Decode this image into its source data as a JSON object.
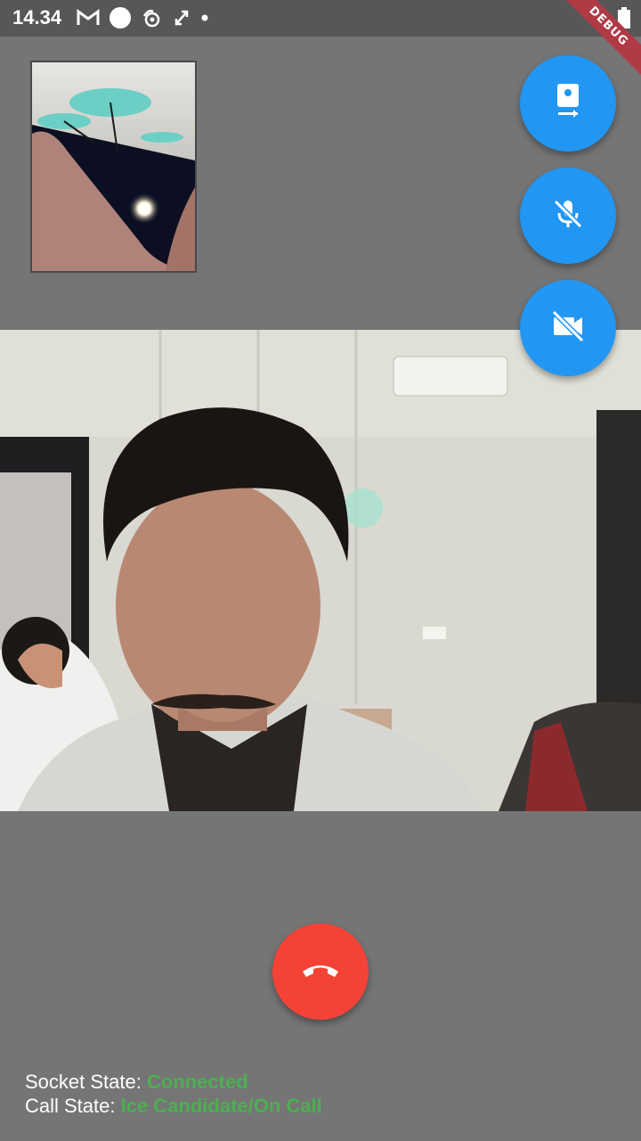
{
  "status_bar": {
    "time": "14.34",
    "icons": [
      "gmail-icon",
      "circle-notification-icon",
      "app-notification-icon",
      "sync-icon",
      "dot-icon"
    ],
    "right_icons": [
      "wifi-icon",
      "battery-icon"
    ]
  },
  "debug_banner": "DEBUG",
  "controls": {
    "switch_camera": "switch-camera-icon",
    "mute_mic": "mic-off-icon",
    "video_off": "videocam-off-icon",
    "hang_up": "call-end-icon"
  },
  "colors": {
    "background": "#757575",
    "fab_blue": "#2196f3",
    "hangup_red": "#f44336",
    "state_green": "#4caf50"
  },
  "info": {
    "socket_label": "Socket State: ",
    "socket_value": "Connected",
    "call_label": "Call State: ",
    "call_value": "Ice Candidate/On Call"
  }
}
